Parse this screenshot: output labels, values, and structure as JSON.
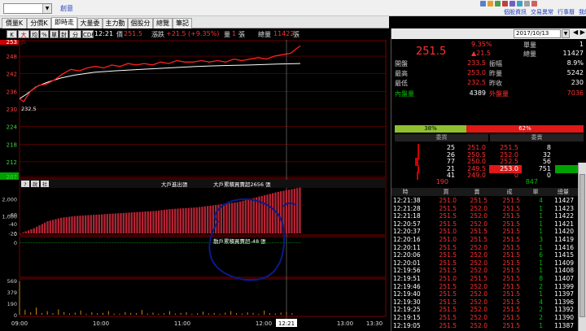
{
  "top": {
    "combo": "",
    "link": "創意",
    "links": [
      "個股資訊",
      "交易異常",
      "行事曆",
      "我的設定"
    ]
  },
  "tabs": [
    "價量K線",
    "分價K線",
    "即時走勢",
    "大量委託",
    "主力動態",
    "個股分析",
    "總覽",
    "筆記"
  ],
  "toolbar": {
    "buttons": [
      "K線",
      "大戶",
      "均",
      "%",
      "單",
      "封",
      "分價",
      "CDP"
    ],
    "time": "12:21",
    "price_label": "價",
    "price": "251.5",
    "chg_label": "漲跌",
    "chg": "+21.5 (+9.35%)",
    "vol_label": "量",
    "vol": "1",
    "vol_unit": "張",
    "total_label": "總量",
    "total": "11422",
    "total_unit": "張"
  },
  "chart": {
    "price_ticks": [
      "253",
      "248",
      "242",
      "236",
      "230",
      "224",
      "218",
      "212",
      "207"
    ],
    "low_label": "232.5",
    "sub_toolbar": [
      "?",
      "說",
      "社"
    ],
    "panel2_label1": "大戶進出張",
    "panel2_label2": "大戶累積買賣超2656 張",
    "panel2_ticks": [
      "2,000",
      "1,000",
      "0"
    ],
    "panel3_label": "散戶累積買賣超-48 張",
    "panel3_ticks": [
      "0",
      "-20",
      "-40",
      "-60"
    ],
    "vol_ticks": [
      "569",
      "379",
      "190",
      "0"
    ],
    "time_ticks": [
      "09:00",
      "10:00",
      "11:00",
      "12:00",
      "13:00",
      "13:30"
    ],
    "cursor_time": "12:21"
  },
  "quote": {
    "date": "2017/10/13",
    "nav": "◀ ▶",
    "price": "251.5",
    "pct": "9.35%",
    "chg": "▲21.5",
    "rows": [
      {
        "k1": "開盤",
        "v1": "233.5",
        "k2": "振幅",
        "v2": "8.9%"
      },
      {
        "k1": "最高",
        "v1": "253.0",
        "k2": "昨量",
        "v2": "5242"
      },
      {
        "k1": "最低",
        "v1": "232.5",
        "k2": "昨收",
        "v2": "230"
      }
    ],
    "top_right": [
      {
        "k": "單量",
        "v": "1"
      },
      {
        "k": "總量",
        "v": "11427"
      }
    ],
    "inner_label": "內盤量",
    "inner": "4389",
    "outer_label": "外盤量",
    "outer": "7036",
    "bar_left": "38%",
    "bar_right": "62%"
  },
  "orderbook": {
    "head_left": "委買",
    "head_right": "委賣",
    "rows": [
      {
        "bq": "25",
        "bp": "251.0",
        "ap": "251.5",
        "aq": "8"
      },
      {
        "bq": "26",
        "bp": "250.5",
        "ap": "252.0",
        "aq": "32"
      },
      {
        "bq": "77",
        "bp": "250.0",
        "ap": "252.5",
        "aq": "56"
      },
      {
        "bq": "21",
        "bp": "249.5",
        "ap": "253.0",
        "aq": "751"
      },
      {
        "bq": "41",
        "bp": "249.0",
        "ap": "0",
        "aq": "0"
      }
    ],
    "sum_left": "190",
    "sum_right": "847"
  },
  "ticks": {
    "headers": [
      "時",
      "買",
      "賣",
      "成",
      "單",
      "總量"
    ],
    "rows": [
      [
        "12:21:38",
        "251.0",
        "251.5",
        "251.5",
        "4",
        "11427"
      ],
      [
        "12:21:28",
        "251.5",
        "252.0",
        "251.5",
        "1",
        "11423"
      ],
      [
        "12:21:18",
        "251.5",
        "252.0",
        "251.5",
        "1",
        "11422"
      ],
      [
        "12:20:57",
        "251.5",
        "252.0",
        "251.5",
        "1",
        "11421"
      ],
      [
        "12:20:37",
        "251.0",
        "251.5",
        "251.5",
        "1",
        "11420"
      ],
      [
        "12:20:16",
        "251.0",
        "251.5",
        "251.5",
        "3",
        "11419"
      ],
      [
        "12:20:11",
        "251.5",
        "252.0",
        "251.5",
        "1",
        "11416"
      ],
      [
        "12:20:06",
        "251.5",
        "252.0",
        "251.5",
        "6",
        "11415"
      ],
      [
        "12:20:01",
        "251.5",
        "252.0",
        "251.5",
        "1",
        "11409"
      ],
      [
        "12:19:56",
        "251.5",
        "252.0",
        "251.5",
        "1",
        "11408"
      ],
      [
        "12:19:51",
        "251.0",
        "251.5",
        "251.5",
        "8",
        "11407"
      ],
      [
        "12:19:46",
        "251.5",
        "252.0",
        "251.5",
        "2",
        "11399"
      ],
      [
        "12:19:40",
        "251.5",
        "252.0",
        "251.5",
        "1",
        "11397"
      ],
      [
        "12:19:30",
        "251.5",
        "252.0",
        "251.5",
        "4",
        "11396"
      ],
      [
        "12:19:25",
        "251.5",
        "252.0",
        "251.5",
        "2",
        "11392"
      ],
      [
        "12:19:15",
        "251.5",
        "252.0",
        "251.5",
        "2",
        "11390"
      ],
      [
        "12:19:05",
        "251.5",
        "252.0",
        "251.5",
        "1",
        "11387"
      ]
    ]
  },
  "colors": {
    "up": "#ff3030",
    "down": "#00c000",
    "grid": "#7a0000",
    "price_line": "#ff2020",
    "avg_line": "#ffffff",
    "inst_bar": "#c8283a",
    "retail_bar": "#00a000",
    "vol_bar": "#d08020",
    "annot": "#0a1a8a"
  },
  "series": {
    "price": [
      [
        0,
        233.5
      ],
      [
        3,
        232.5
      ],
      [
        8,
        236
      ],
      [
        14,
        238
      ],
      [
        20,
        238.5
      ],
      [
        26,
        240
      ],
      [
        32,
        242
      ],
      [
        38,
        243.5
      ],
      [
        44,
        243
      ],
      [
        50,
        244
      ],
      [
        56,
        244.5
      ],
      [
        62,
        244
      ],
      [
        68,
        245
      ],
      [
        74,
        244.5
      ],
      [
        80,
        245.5
      ],
      [
        86,
        245
      ],
      [
        92,
        245.5
      ],
      [
        98,
        245
      ],
      [
        104,
        246
      ],
      [
        110,
        245.5
      ],
      [
        116,
        246.5
      ],
      [
        122,
        246
      ],
      [
        128,
        246
      ],
      [
        134,
        246.5
      ],
      [
        140,
        246
      ],
      [
        146,
        246.5
      ],
      [
        152,
        246
      ],
      [
        158,
        247
      ],
      [
        164,
        246.5
      ],
      [
        170,
        247
      ],
      [
        176,
        247.5
      ],
      [
        182,
        247
      ],
      [
        188,
        248
      ],
      [
        194,
        248.5
      ],
      [
        200,
        249
      ],
      [
        204,
        250.5
      ],
      [
        207,
        251.5
      ]
    ],
    "avg": [
      [
        0,
        233.5
      ],
      [
        5,
        235
      ],
      [
        12,
        237.5
      ],
      [
        20,
        239
      ],
      [
        30,
        240.5
      ],
      [
        40,
        241.5
      ],
      [
        55,
        242.5
      ],
      [
        70,
        243
      ],
      [
        90,
        243.5
      ],
      [
        110,
        244
      ],
      [
        130,
        244.5
      ],
      [
        150,
        244.8
      ],
      [
        170,
        245
      ],
      [
        190,
        245.3
      ],
      [
        207,
        245.5
      ]
    ],
    "inst": [
      [
        0,
        0
      ],
      [
        10,
        300
      ],
      [
        20,
        700
      ],
      [
        30,
        900
      ],
      [
        40,
        1000
      ],
      [
        50,
        1050
      ],
      [
        60,
        1100
      ],
      [
        70,
        1150
      ],
      [
        80,
        1200
      ],
      [
        90,
        1250
      ],
      [
        100,
        1300
      ],
      [
        110,
        1400
      ],
      [
        120,
        1450
      ],
      [
        130,
        1500
      ],
      [
        140,
        1600
      ],
      [
        150,
        1700
      ],
      [
        160,
        1800
      ],
      [
        170,
        2000
      ],
      [
        180,
        2200
      ],
      [
        190,
        2400
      ],
      [
        200,
        2550
      ],
      [
        207,
        2656
      ]
    ],
    "retail": [
      [
        0,
        0
      ],
      [
        10,
        -2
      ],
      [
        20,
        -5
      ],
      [
        30,
        -10
      ],
      [
        40,
        -20
      ],
      [
        50,
        -30
      ],
      [
        60,
        -40
      ],
      [
        70,
        -45
      ],
      [
        80,
        -48
      ],
      [
        90,
        -50
      ],
      [
        100,
        -55
      ],
      [
        110,
        -60
      ],
      [
        120,
        -62
      ],
      [
        130,
        -60
      ],
      [
        140,
        -58
      ],
      [
        150,
        -55
      ],
      [
        160,
        -52
      ],
      [
        170,
        -50
      ],
      [
        180,
        -48
      ],
      [
        190,
        -50
      ],
      [
        200,
        -52
      ],
      [
        207,
        -48
      ]
    ]
  }
}
